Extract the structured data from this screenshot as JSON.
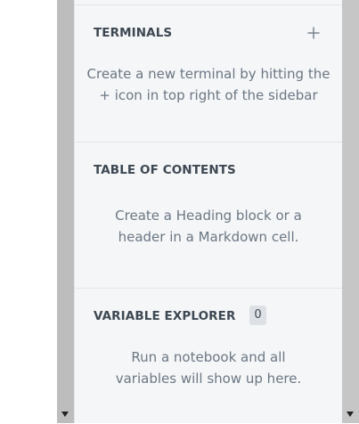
{
  "terminals": {
    "title": "TERMINALS",
    "add_icon": "plus-icon",
    "description_line1": "Create a new terminal by hitting the",
    "description_line2": "+ icon in top right of the sidebar"
  },
  "toc": {
    "title": "TABLE OF CONTENTS",
    "description_line1": "Create a Heading block or a",
    "description_line2": "header in a Markdown cell."
  },
  "variables": {
    "title": "VARIABLE EXPLORER",
    "count": "0",
    "description_line1": "Run a notebook and all",
    "description_line2": "variables will show up here."
  }
}
